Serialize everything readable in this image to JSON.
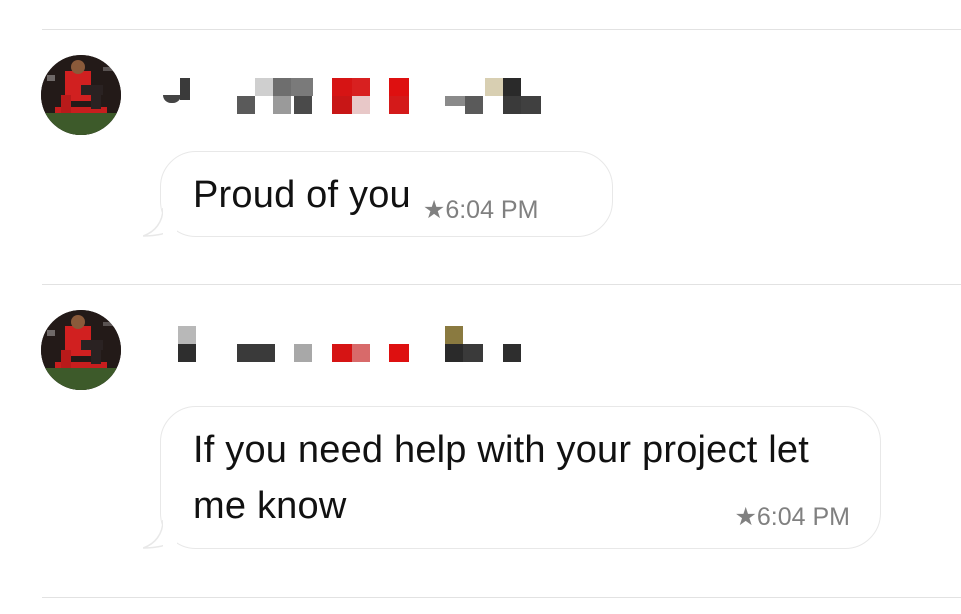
{
  "thread": {
    "messages": [
      {
        "sender_name": "",
        "text": "Proud of you",
        "timestamp": "6:04 PM",
        "starred": true
      },
      {
        "sender_name": "",
        "text": "If you need help with your project let me know",
        "timestamp": "6:04 PM",
        "starred": true
      }
    ]
  },
  "icons": {
    "star": "star-icon",
    "avatar": "avatar"
  },
  "colors": {
    "bubble_border": "#e8e8e8",
    "timestamp": "#808080",
    "divider": "#e2e2e2",
    "text": "#111111"
  }
}
